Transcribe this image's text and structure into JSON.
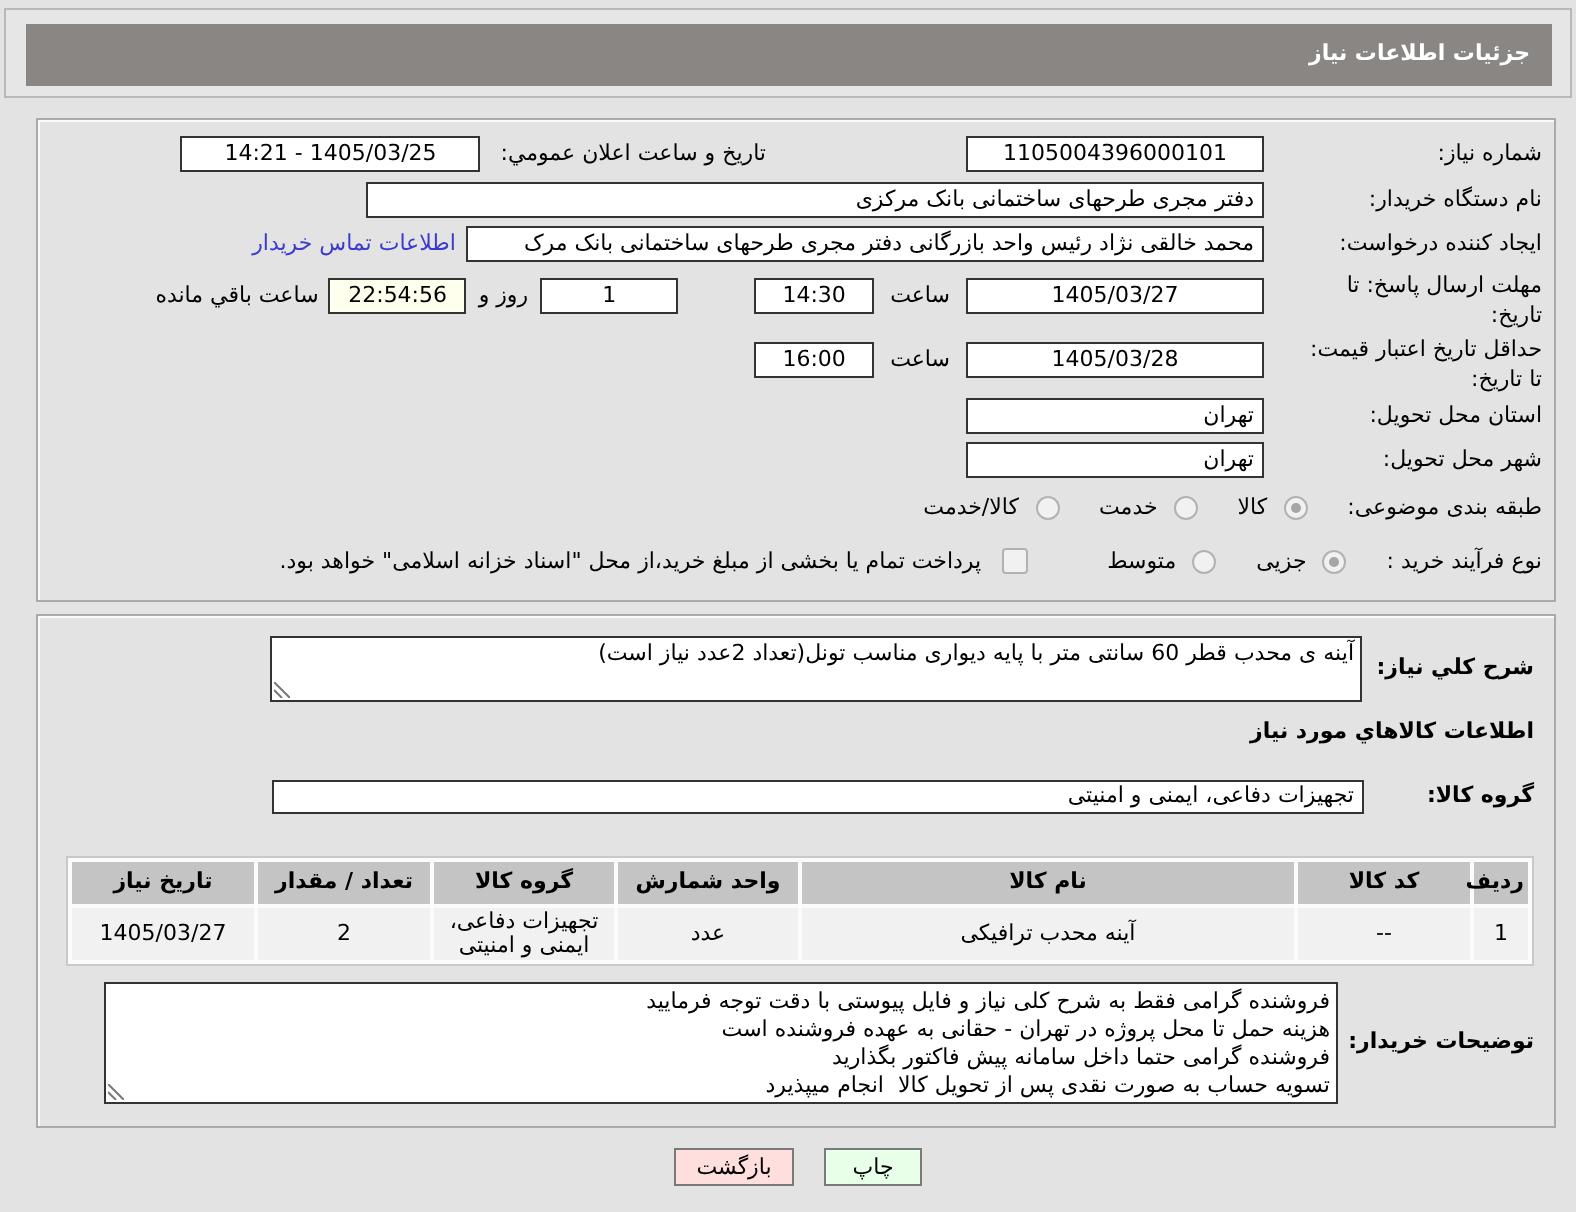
{
  "header": {
    "title": "جزئیات اطلاعات نیاز"
  },
  "form": {
    "need_number": {
      "label": "شماره نیاز:",
      "value": "1105004396000101"
    },
    "announcement": {
      "label": "تاریخ و ساعت اعلان عمومي:",
      "value": "1405/03/25 - 14:21"
    },
    "buyer_organization": {
      "label": "نام دستگاه خریدار:",
      "value": "دفتر مجری طرحهای ساختمانی بانک مرکزی"
    },
    "requester": {
      "label": "ایجاد کننده درخواست:",
      "value": "محمد خالقی نژاد رئیس واحد بازرگانی دفتر مجری طرحهای ساختمانی بانک مرک",
      "link": "اطلاعات تماس خریدار"
    },
    "reply_deadline": {
      "label": "مهلت ارسال پاسخ: تا تاریخ:",
      "date": "1405/03/27",
      "time_label": "ساعت",
      "time": "14:30",
      "days": "1",
      "days_label": "روز و",
      "remaining": "22:54:56",
      "remaining_label": "ساعت باقي مانده"
    },
    "price_validity": {
      "label": "حداقل تاریخ اعتبار قیمت: تا تاریخ:",
      "date": "1405/03/28",
      "time_label": "ساعت",
      "time": "16:00"
    },
    "delivery_province": {
      "label": "استان محل تحویل:",
      "value": "تهران"
    },
    "delivery_city": {
      "label": "شهر محل تحویل:",
      "value": "تهران"
    },
    "category": {
      "label": "طبقه بندی موضوعی:",
      "options": [
        {
          "label": "کالا",
          "selected": true,
          "disabled": true
        },
        {
          "label": "خدمت",
          "selected": false,
          "disabled": true
        },
        {
          "label": "کالا/خدمت",
          "selected": false,
          "disabled": true
        }
      ]
    },
    "purchase_process": {
      "label": "نوع فرآیند خرید :",
      "options": [
        {
          "label": "جزیی",
          "selected": true,
          "disabled": true
        },
        {
          "label": "متوسط",
          "selected": false,
          "disabled": true
        }
      ],
      "treasury_payment": {
        "label": "پرداخت تمام یا بخشی از مبلغ خرید،از محل \"اسناد خزانه اسلامی\" خواهد بود.",
        "checked": false,
        "disabled": true
      }
    }
  },
  "details": {
    "description": {
      "label": "شرح کلي نیاز:",
      "value": "آینه ی محدب قطر 60 سانتی متر با پایه دیواری مناسب تونل(تعداد 2عدد نیاز است)"
    },
    "items_title": "اطلاعات کالاهاي مورد نیاز",
    "goods_group": {
      "label": "گروه کالا:",
      "value": "تجهیزات دفاعی، ایمنی و امنیتی"
    },
    "table": {
      "columns": [
        "ردیف",
        "کد کالا",
        "نام کالا",
        "واحد شمارش",
        "گروه کالا",
        "تعداد / مقدار",
        "تاریخ نیاز"
      ],
      "rows": [
        {
          "cells": [
            "1",
            "--",
            "آینه محدب ترافیکی",
            "عدد",
            "تجهیزات دفاعی، ایمنی و امنیتی",
            "2",
            "1405/03/27"
          ]
        }
      ]
    },
    "buyer_notes": {
      "label": "توضیحات خریدار:",
      "lines": [
        "فروشنده گرامی فقط به شرح کلی نیاز و فایل پیوستی با دقت توجه فرمایید",
        "هزینه حمل تا محل پروژه در تهران - حقانی به عهده فروشنده است",
        "فروشنده گرامی حتما داخل سامانه پیش فاکتور بگذارید",
        "تسویه حساب به صورت نقدی پس از تحویل کالا  انجام میپذیرد"
      ]
    }
  },
  "buttons": [
    {
      "label": "چاپ",
      "kind": "print"
    },
    {
      "label": "بازگشت",
      "kind": "back"
    }
  ]
}
